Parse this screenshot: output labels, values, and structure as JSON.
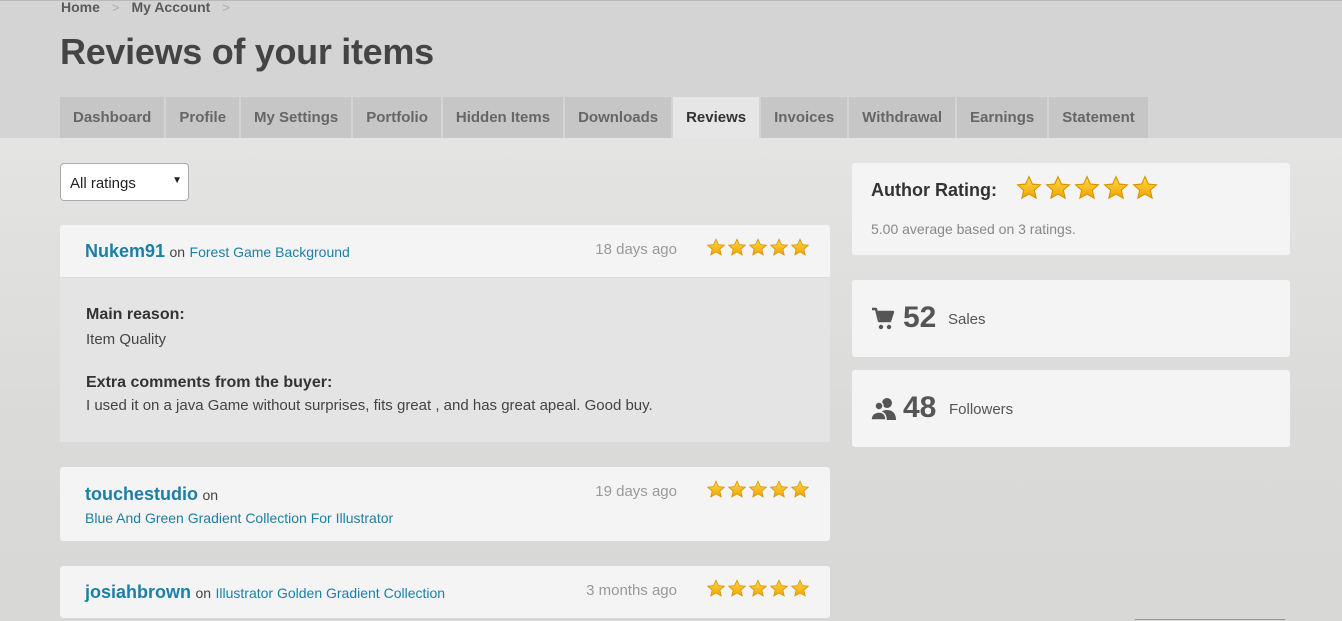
{
  "breadcrumb": [
    "Home",
    "My Account"
  ],
  "page_title": "Reviews of your items",
  "tabs": [
    {
      "label": "Dashboard"
    },
    {
      "label": "Profile"
    },
    {
      "label": "My Settings"
    },
    {
      "label": "Portfolio"
    },
    {
      "label": "Hidden Items"
    },
    {
      "label": "Downloads"
    },
    {
      "label": "Reviews",
      "active": true
    },
    {
      "label": "Invoices"
    },
    {
      "label": "Withdrawal"
    },
    {
      "label": "Earnings"
    },
    {
      "label": "Statement"
    }
  ],
  "filter": {
    "selected": "All ratings"
  },
  "reviews": [
    {
      "reviewer": "Nukem91",
      "on": "on",
      "item": "Forest Game Background",
      "time": "18 days ago",
      "stars": 5,
      "main_reason_label": "Main reason:",
      "main_reason": "Item Quality",
      "extra_label": "Extra comments from the buyer:",
      "extra": "I used it on a java Game without surprises, fits great , and has great apeal. Good buy."
    },
    {
      "reviewer": "touchestudio",
      "on": "on",
      "item": "Blue And Green Gradient Collection For Illustrator",
      "time": "19 days ago",
      "stars": 5
    },
    {
      "reviewer": "josiahbrown",
      "on": "on",
      "item": "Illustrator Golden Gradient Collection",
      "time": "3 months ago",
      "stars": 5
    }
  ],
  "author_rating": {
    "label": "Author Rating:",
    "stars": 5,
    "note": "5.00 average based on 3 ratings."
  },
  "stats": {
    "sales": {
      "value": "52",
      "label": "Sales",
      "icon": "cart-icon"
    },
    "followers": {
      "value": "48",
      "label": "Followers",
      "icon": "followers-icon"
    }
  },
  "colors": {
    "link": "#1c7fa6",
    "star": "#f5b400",
    "active_tab": "#e6e6e6"
  }
}
